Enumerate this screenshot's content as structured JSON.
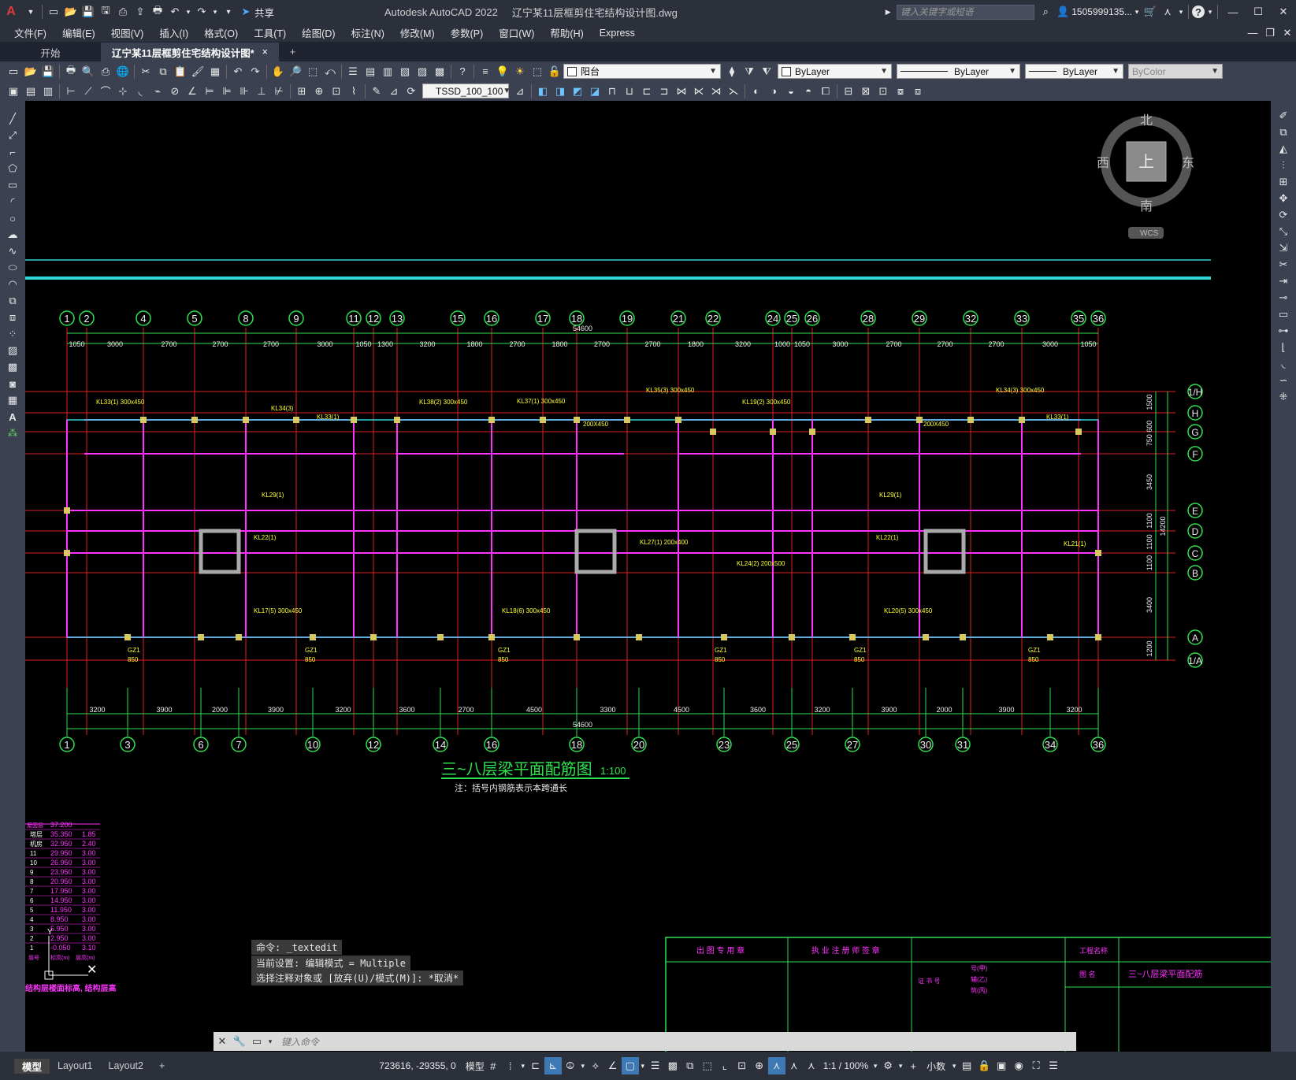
{
  "app": {
    "logo": "A",
    "title": "Autodesk AutoCAD 2022",
    "filename": "辽宁某11层框剪住宅结构设计图.dwg",
    "share_label": "共享",
    "search_placeholder": "键入关键字或短语",
    "user": "1505999135...",
    "help": "?"
  },
  "menu": [
    "文件(F)",
    "编辑(E)",
    "视图(V)",
    "插入(I)",
    "格式(O)",
    "工具(T)",
    "绘图(D)",
    "标注(N)",
    "修改(M)",
    "参数(P)",
    "窗口(W)",
    "帮助(H)",
    "Express"
  ],
  "tabs": {
    "start": "开始",
    "active": "辽宁某11层框剪住宅结构设计图*",
    "close": "×",
    "add": "+"
  },
  "toolbar": {
    "layer": "阳台",
    "color": "ByLayer",
    "linetype": "ByLayer",
    "lineweight": "ByLayer",
    "plotstyle": "ByColor",
    "dimstyle": "TSSD_100_100"
  },
  "viewcube": {
    "north": "北",
    "south": "南",
    "east": "东",
    "west": "西",
    "top": "上",
    "wcs": "WCS"
  },
  "drawing": {
    "top_axes": [
      "1",
      "2",
      "4",
      "5",
      "8",
      "9",
      "11",
      "12",
      "13",
      "15",
      "16",
      "17",
      "18",
      "19",
      "21",
      "22",
      "24",
      "25",
      "26",
      "28",
      "29",
      "32",
      "33",
      "35",
      "36"
    ],
    "top_dims": [
      "1050",
      "3000",
      "2700",
      "2700",
      "2700",
      "3000",
      "1050",
      "1300",
      "3200",
      "1800",
      "2700",
      "1800",
      "2700",
      "2700",
      "1800",
      "3200",
      "1000",
      "1050",
      "3000",
      "2700",
      "2700",
      "2700",
      "3000",
      "1050"
    ],
    "top_total": "54600",
    "bottom_axes": [
      "1",
      "3",
      "6",
      "7",
      "10",
      "12",
      "14",
      "16",
      "18",
      "20",
      "23",
      "25",
      "27",
      "30",
      "31",
      "34",
      "36"
    ],
    "bottom_dims": [
      "3200",
      "3900",
      "2000",
      "3900",
      "3200",
      "3600",
      "2700",
      "4500",
      "3300",
      "4500",
      "3600",
      "3200",
      "3900",
      "2000",
      "3900",
      "3200"
    ],
    "bottom_total": "54600",
    "right_axes": [
      "1/H",
      "H",
      "G",
      "F",
      "E",
      "D",
      "C",
      "B",
      "A",
      "1/A"
    ],
    "right_dims": [
      "1500",
      "750 600",
      "3450",
      "1100",
      "1100",
      "1100",
      "3400",
      "1200"
    ],
    "right_total": "14200",
    "title": "三~八层梁平面配筋图",
    "scale": "1:100",
    "note": "注：括号内钢筋表示本跨通长",
    "beam_labels": [
      "KL33(1) 300x450",
      "KL34(3)",
      "KL33(1)",
      "KL38(2) 300x450",
      "KL37(1) 300x450",
      "KL35(3) 300x450",
      "KL19(2) 300x450",
      "KL34(3) 300x450",
      "KL33(1)",
      "KL29(1)",
      "KL29(1)",
      "KL22(1)",
      "KL22(1)",
      "KL21(1)",
      "KL17(5) 300x450",
      "KL18(6) 300x450",
      "KL20(5) 300x450",
      "KL27(1) 200x400",
      "KL24(2) 200x500",
      "GZ1",
      "GZ1",
      "GZ1",
      "GZ1",
      "GZ1",
      "GZ1",
      "200X450",
      "200X450",
      "850",
      "850",
      "850",
      "850",
      "850",
      "850"
    ]
  },
  "level_table": {
    "header": [
      "屋面层",
      "37.200"
    ],
    "rows": [
      [
        "塔层",
        "35.350",
        "1.85"
      ],
      [
        "机房",
        "32.950",
        "2.40"
      ],
      [
        "11",
        "29.950",
        "3.00"
      ],
      [
        "10",
        "26.950",
        "3.00"
      ],
      [
        "9",
        "23.950",
        "3.00"
      ],
      [
        "8",
        "20.950",
        "3.00"
      ],
      [
        "7",
        "17.950",
        "3.00"
      ],
      [
        "6",
        "14.950",
        "3.00"
      ],
      [
        "5",
        "11.950",
        "3.00"
      ],
      [
        "4",
        "8.950",
        "3.00"
      ],
      [
        "3",
        "5.950",
        "3.00"
      ],
      [
        "2",
        "2.950",
        "3.00"
      ],
      [
        "1",
        "-0.050",
        "3.10"
      ]
    ],
    "footer": [
      "层号",
      "标高(m)",
      "层高(m)"
    ],
    "caption": "结构层楼面标高, 结构层高"
  },
  "titleblock": {
    "col1": "出 图 专 用 章",
    "col2": "执 业 注 册 师 签 章",
    "col3": "证 书 号",
    "project": "工程名称",
    "drawing_name_label": "图 名",
    "drawing_name": "三~八层梁平面配筋",
    "cells": [
      "号(甲)",
      "辅(乙)",
      "筑(丙)"
    ]
  },
  "command": {
    "history": [
      "命令: _textedit",
      "当前设置: 编辑模式 = Multiple",
      "选择注释对象或 [放弃(U)/模式(M)]: *取消*"
    ],
    "placeholder": "键入命令"
  },
  "layouts": [
    "模型",
    "Layout1",
    "Layout2"
  ],
  "status": {
    "coords": "723616, -29355, 0",
    "model": "模型",
    "scale": "1:1 / 100%",
    "units": "小数"
  }
}
